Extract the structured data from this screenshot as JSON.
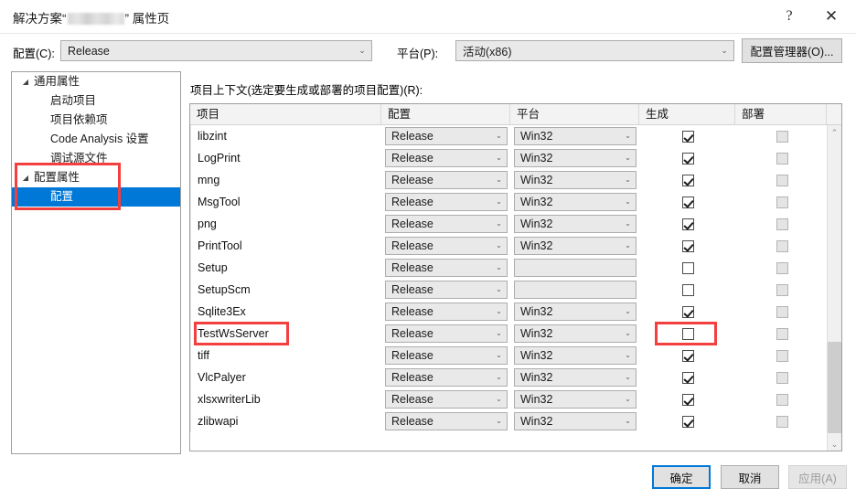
{
  "window": {
    "title_prefix": "解决方案“",
    "title_suffix": "” 属性页",
    "help_icon": "?",
    "close_icon": "✕"
  },
  "config_bar": {
    "config_label": "配置(C):",
    "config_value": "Release",
    "platform_label": "平台(P):",
    "platform_value": "活动(x86)",
    "config_manager_button": "配置管理器(O)...",
    "dropdown_arrow": "⌄"
  },
  "tree": {
    "items": [
      {
        "label": "通用属性",
        "level": 1,
        "expander": "◢",
        "selected": false
      },
      {
        "label": "启动项目",
        "level": 2,
        "expander": "",
        "selected": false
      },
      {
        "label": "项目依赖项",
        "level": 2,
        "expander": "",
        "selected": false
      },
      {
        "label": "Code Analysis 设置",
        "level": 2,
        "expander": "",
        "selected": false
      },
      {
        "label": "调试源文件",
        "level": 2,
        "expander": "",
        "selected": false
      },
      {
        "label": "配置属性",
        "level": 1,
        "expander": "◢",
        "selected": false
      },
      {
        "label": "配置",
        "level": 2,
        "expander": "",
        "selected": true
      }
    ]
  },
  "list": {
    "caption": "项目上下文(选定要生成或部署的项目配置)(R):",
    "columns": [
      "项目",
      "配置",
      "平台",
      "生成",
      "部署"
    ],
    "rows": [
      {
        "project": "libzint",
        "config": "Release",
        "platform": "Win32",
        "build": true,
        "deploy": false
      },
      {
        "project": "LogPrint",
        "config": "Release",
        "platform": "Win32",
        "build": true,
        "deploy": false
      },
      {
        "project": "mng",
        "config": "Release",
        "platform": "Win32",
        "build": true,
        "deploy": false
      },
      {
        "project": "MsgTool",
        "config": "Release",
        "platform": "Win32",
        "build": true,
        "deploy": false
      },
      {
        "project": "png",
        "config": "Release",
        "platform": "Win32",
        "build": true,
        "deploy": false
      },
      {
        "project": "PrintTool",
        "config": "Release",
        "platform": "Win32",
        "build": true,
        "deploy": false
      },
      {
        "project": "Setup",
        "config": "Release",
        "platform": "",
        "build": false,
        "deploy": false
      },
      {
        "project": "SetupScm",
        "config": "Release",
        "platform": "",
        "build": false,
        "deploy": false
      },
      {
        "project": "Sqlite3Ex",
        "config": "Release",
        "platform": "Win32",
        "build": true,
        "deploy": false
      },
      {
        "project": "TestWsServer",
        "config": "Release",
        "platform": "Win32",
        "build": false,
        "deploy": false
      },
      {
        "project": "tiff",
        "config": "Release",
        "platform": "Win32",
        "build": true,
        "deploy": false
      },
      {
        "project": "VlcPalyer",
        "config": "Release",
        "platform": "Win32",
        "build": true,
        "deploy": false
      },
      {
        "project": "xlsxwriterLib",
        "config": "Release",
        "platform": "Win32",
        "build": true,
        "deploy": false
      },
      {
        "project": "zlibwapi",
        "config": "Release",
        "platform": "Win32",
        "build": true,
        "deploy": false
      }
    ],
    "scroll_up_icon": "⌃",
    "scroll_down_icon": "⌄"
  },
  "footer": {
    "ok": "确定",
    "cancel": "取消",
    "apply": "应用(A)"
  },
  "colors": {
    "selection": "#0078D7",
    "annotation": "#F43F3F"
  }
}
